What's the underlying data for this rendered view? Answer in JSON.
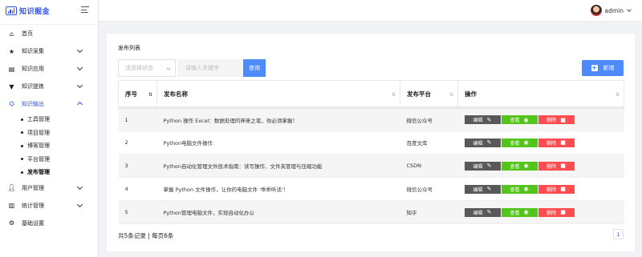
{
  "app": {
    "logo_text": "知识掘金",
    "user_name": "admin"
  },
  "sidebar": {
    "items": [
      {
        "label": "首页",
        "icon": "home-icon"
      },
      {
        "label": "知识采集",
        "icon": "star-icon"
      },
      {
        "label": "知识应用",
        "icon": "book-icon"
      },
      {
        "label": "知识提炼",
        "icon": "filter-icon"
      },
      {
        "label": "知识输出",
        "icon": "user-export-icon"
      },
      {
        "label": "用户管理",
        "icon": "user-icon"
      },
      {
        "label": "统计管理",
        "icon": "bar-chart-icon"
      },
      {
        "label": "基础设置",
        "icon": "gear-icon"
      }
    ],
    "sub_items": [
      "工具管理",
      "项目管理",
      "博客管理",
      "平台管理",
      "发布管理"
    ]
  },
  "panel": {
    "title": "发布列表",
    "status_placeholder": "请选择状态",
    "keyword_placeholder": "请输入关键字",
    "query_label": "查询",
    "add_label": "新增"
  },
  "table": {
    "headers": {
      "index": "序号",
      "name": "发布名称",
      "platform": "发布平台",
      "ops": "操作"
    },
    "rows": [
      {
        "index": "1",
        "name": "Python 操作 Excel：数据处理的神来之笔，你必须掌握！",
        "platform": "微信公众号"
      },
      {
        "index": "2",
        "name": "Python电脑文件操作",
        "platform": "百度文库"
      },
      {
        "index": "3",
        "name": "Python自动化管理文件技术指南：读写操作、文件夹管理与压缩功能",
        "platform": "CSDN"
      },
      {
        "index": "4",
        "name": "掌握 Python 文件操作，让你的电脑文件 '乖乖听话'！",
        "platform": "微信公众号"
      },
      {
        "index": "5",
        "name": "Python管理电脑文件，实现自动化办公",
        "platform": "知乎"
      }
    ],
    "ops": {
      "edit": "编辑",
      "view": "查看",
      "delete": "删除"
    }
  },
  "pagination": {
    "summary": "共5条记录 | 每页6条",
    "current_page": "1"
  },
  "colors": {
    "primary": "#4d8bfb",
    "edit": "#595959",
    "view": "#52c41a",
    "delete": "#ff4d4f"
  }
}
